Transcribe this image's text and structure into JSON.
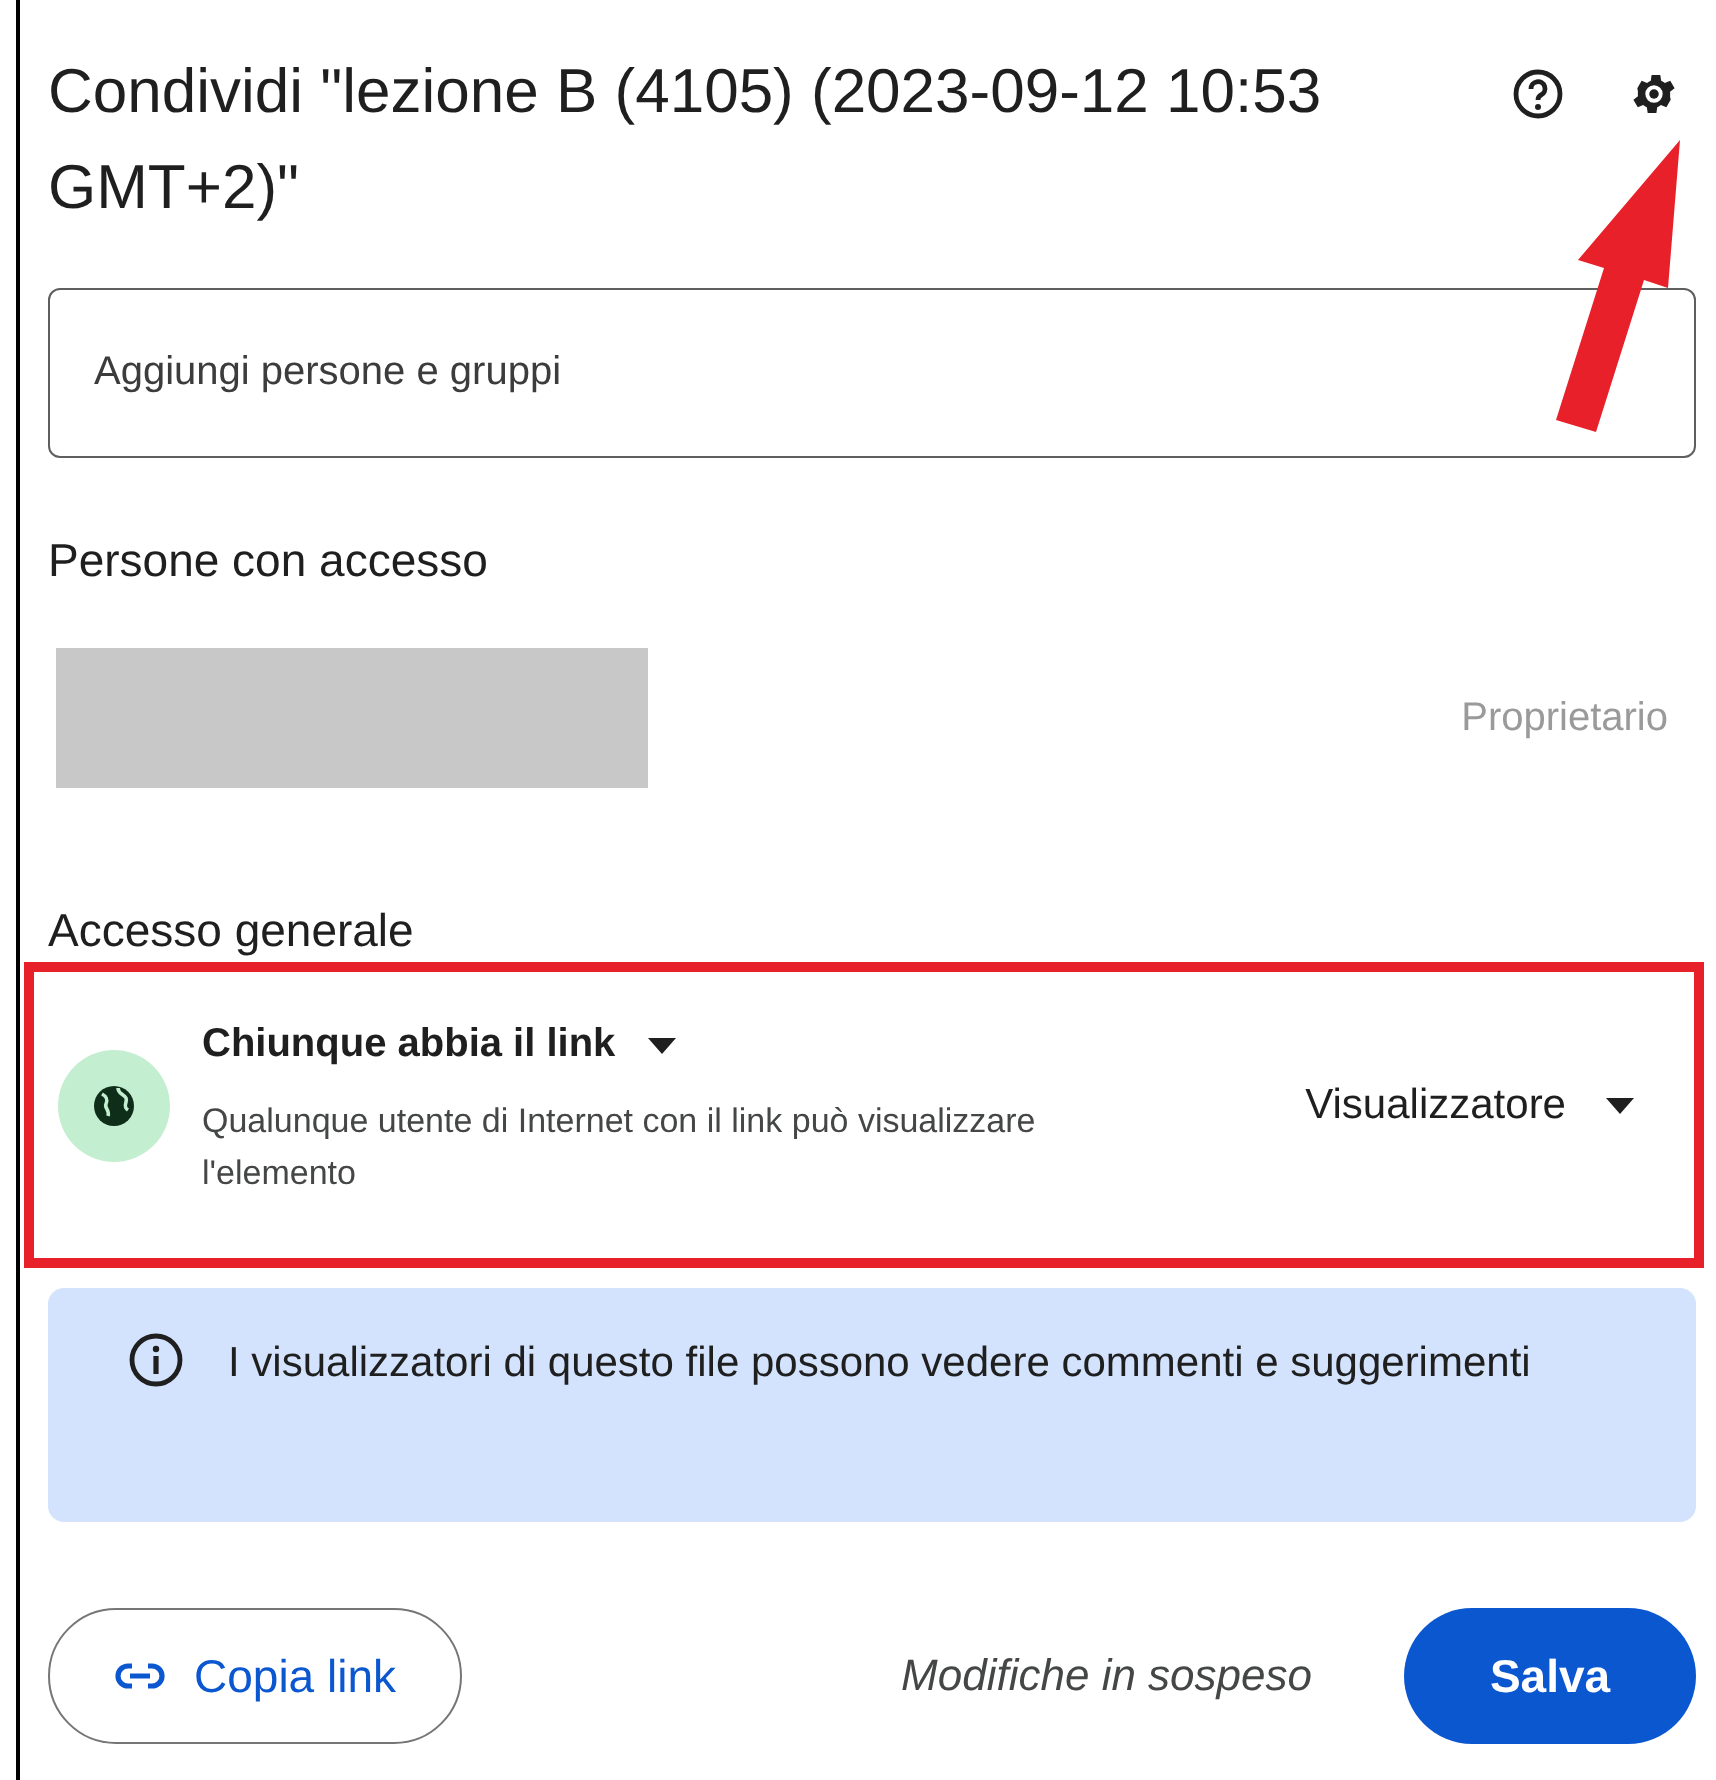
{
  "dialog": {
    "title": "Condividi \"lezione B (4105) (2023-09-12 10:53 GMT+2)\""
  },
  "add_field": {
    "placeholder": "Aggiungi persone e gruppi"
  },
  "people_section": {
    "heading": "Persone con accesso",
    "people": [
      {
        "redacted": true,
        "role": "Proprietario"
      }
    ]
  },
  "general_access": {
    "heading": "Accesso generale",
    "highlighted": true,
    "scope": "Chiunque abbia il link",
    "description": "Qualunque utente di Internet con il link può visualizzare l'elemento",
    "role": "Visualizzatore"
  },
  "info_banner": {
    "text": "I visualizzatori di questo file possono vedere commenti e suggerimenti"
  },
  "footer": {
    "copy_link": "Copia link",
    "status": "Modifiche in sospeso",
    "save": "Salva"
  },
  "annotation_arrow": true
}
